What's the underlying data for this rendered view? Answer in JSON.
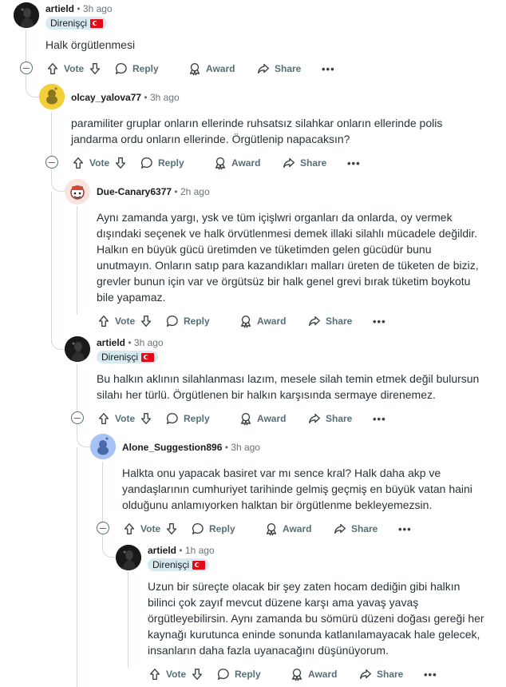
{
  "comments": [
    {
      "username": "artield",
      "time": "3h ago",
      "flair": "Direnişçi",
      "body": "Halk örgütlenmesi",
      "avatar": "dark-figure-avatar"
    },
    {
      "username": "olcay_yalova77",
      "time": "3h ago",
      "flair": "",
      "body": "paramiliter gruplar onların ellerinde ruhsatsız silahkar onların ellerinde polis jandarma ordu onların ellerinde. Örgütlenip napacaksın?",
      "avatar": "yellow-snoo-avatar"
    },
    {
      "username": "Due-Canary6377",
      "time": "2h ago",
      "flair": "",
      "body": "Aynı zamanda yargı, ysk ve tüm içişlwri organları da onlarda, oy vermek dışındaki seçenek ve halk örvütlenmesi demek illaki silahlı mücadele değildir. Halkın en büyük gücü üretimden ve tüketimden gelen gücüdür bunu unutmayın. Onların satıp para kazandıkları malları üreten de tüketen de biziz, grevler bunun için var ve örgütsüz bir halk genel grevi bırak tüketim boykotu bile yapamaz.",
      "avatar": "red-snoo-avatar"
    },
    {
      "username": "artield",
      "time": "3h ago",
      "flair": "Direnişçi",
      "body": "Bu halkın aklının silahlanması lazım, mesele silah temin etmek değil bulursun silahı her türlü. Örgütlenen bir halkın karşısında sermaye direnemez.",
      "avatar": "dark-figure-avatar"
    },
    {
      "username": "Alone_Suggestion896",
      "time": "3h ago",
      "flair": "",
      "body": "Halkta onu yapacak basiret var mı sence kral? Halk daha akp ve yandaşlarının cumhuriyet tarihinde gelmiş geçmiş en büyük vatan haini olduğunu anlamıyorken halktan bir örgütlenme bekleyemezsin.",
      "avatar": "blue-snoo-avatar"
    },
    {
      "username": "artield",
      "time": "1h ago",
      "flair": "Direnişçi",
      "body": "Uzun bir süreçte olacak bir şey zaten hocam dediğin gibi halkın bilinci çok zayıf mevcut düzene karşı ama yavaş yavaş örgütleyebilirsin. Aynı zamanda bu sömürü düzeni doğası gereği her kaynağı kurutunca eninde sonunda katlanılamayacak hale gelecek, insanların daha fazla uyanacağını düşünüyorum.",
      "avatar": "dark-figure-avatar"
    }
  ],
  "actions": {
    "vote": "Vote",
    "reply": "Reply",
    "award": "Award",
    "share": "Share",
    "more": "•••"
  },
  "meta_separator": "•",
  "colors": {
    "flair_bg": "#d7eaf2",
    "thread_line": "#d4d9dc",
    "action_text": "#576f76",
    "flag_red": "#e30a17"
  }
}
